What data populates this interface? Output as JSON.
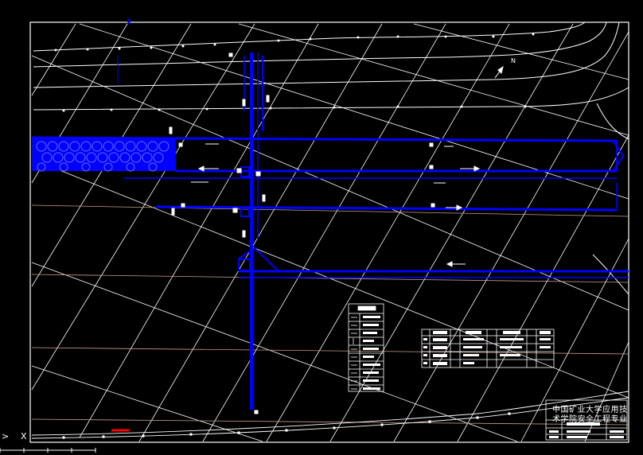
{
  "drawing": {
    "title_line1": "中国矿业大学应用技",
    "title_line2": "术学院安全工程专业",
    "north_label": "N",
    "axis_arrow": ">",
    "axis_x": "X"
  },
  "colors": {
    "background": "#000000",
    "frame": "#ffffff",
    "roadway": "#0000ff",
    "strata": "#c8a08c",
    "accent_red": "#ff0000"
  }
}
